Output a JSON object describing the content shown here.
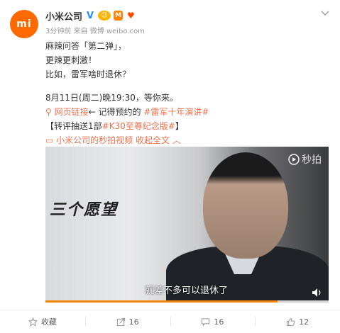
{
  "account": {
    "avatar_text": "mi",
    "name": "小米公司",
    "verified_mark": "V",
    "meta": "3分钟前 来自 微博 weibo.com"
  },
  "post": {
    "lines": [
      "麻辣问答「第二弹」，",
      "更辣更刺激！",
      "比如，雷军啥时退休？"
    ],
    "event_line": "8月11日(周二)晚19:30，等你来。",
    "link_label": "网页链接",
    "link_middle": "← 记得预约的",
    "link_tag": "#雷军十年演讲#",
    "promo_prefix": "【转评抽送1部",
    "promo_tag": "#K30至尊纪念版#",
    "promo_suffix": "】",
    "video_source": "小米公司的秒拍视频",
    "collapse_label": "收起全文"
  },
  "video": {
    "overlay_text": "三个愿望",
    "subtitle": "就差不多可以退休了",
    "watermark": "秒拍",
    "progress": 0.82
  },
  "actions": {
    "favorite_label": "收藏",
    "repost_count": "16",
    "comment_count": "16",
    "like_count": "12"
  },
  "colors": {
    "brand_orange": "#ff6900",
    "link": "#eb7350",
    "progress": "#ff8200"
  }
}
